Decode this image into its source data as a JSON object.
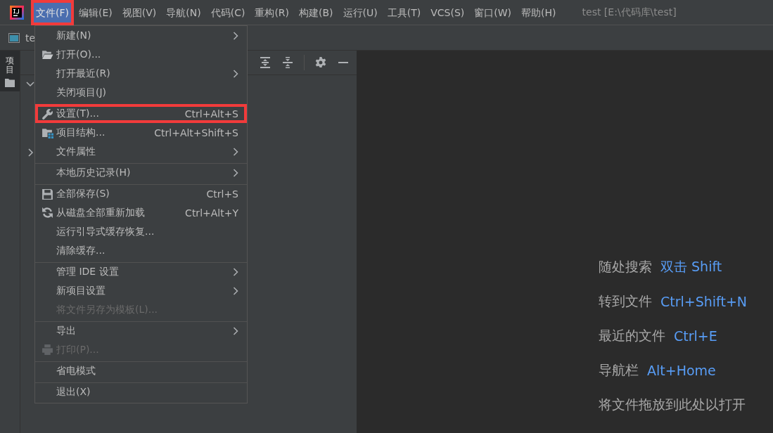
{
  "menubar": {
    "items": [
      {
        "label": "文件(F)",
        "selected": true,
        "outlined": true
      },
      {
        "label": "编辑(E)",
        "selected": false,
        "outlined": false
      },
      {
        "label": "视图(V)",
        "selected": false,
        "outlined": false
      },
      {
        "label": "导航(N)",
        "selected": false,
        "outlined": false
      },
      {
        "label": "代码(C)",
        "selected": false,
        "outlined": false
      },
      {
        "label": "重构(R)",
        "selected": false,
        "outlined": false
      },
      {
        "label": "构建(B)",
        "selected": false,
        "outlined": false
      },
      {
        "label": "运行(U)",
        "selected": false,
        "outlined": false
      },
      {
        "label": "工具(T)",
        "selected": false,
        "outlined": false
      },
      {
        "label": "VCS(S)",
        "selected": false,
        "outlined": false
      },
      {
        "label": "窗口(W)",
        "selected": false,
        "outlined": false
      },
      {
        "label": "帮助(H)",
        "selected": false,
        "outlined": false
      }
    ],
    "title": "test [E:\\代码库\\test]"
  },
  "tab": {
    "label": "te"
  },
  "side_tab": {
    "label": "项目",
    "selected": true
  },
  "file_menu": {
    "items": [
      {
        "kind": "plain",
        "label": "新建(N)",
        "submenu": true,
        "disabled": false,
        "outlined": false,
        "separator_before": false
      },
      {
        "kind": "folder",
        "label": "打开(O)...",
        "submenu": false,
        "disabled": false,
        "outlined": false,
        "separator_before": false
      },
      {
        "kind": "plain",
        "label": "打开最近(R)",
        "submenu": true,
        "disabled": false,
        "outlined": false,
        "separator_before": false
      },
      {
        "kind": "plain",
        "label": "关闭项目(J)",
        "submenu": false,
        "disabled": false,
        "outlined": false,
        "separator_before": false
      },
      {
        "kind": "wrench",
        "label": "设置(T)...",
        "shortcut": "Ctrl+Alt+S",
        "submenu": false,
        "disabled": false,
        "outlined": true,
        "separator_before": true
      },
      {
        "kind": "structure",
        "label": "项目结构...",
        "shortcut": "Ctrl+Alt+Shift+S",
        "submenu": false,
        "disabled": false,
        "outlined": false,
        "separator_before": false
      },
      {
        "kind": "plain",
        "label": "文件属性",
        "submenu": true,
        "disabled": false,
        "outlined": false,
        "separator_before": false
      },
      {
        "kind": "plain",
        "label": "本地历史记录(H)",
        "submenu": true,
        "disabled": false,
        "outlined": false,
        "separator_before": true
      },
      {
        "kind": "disk",
        "label": "全部保存(S)",
        "shortcut": "Ctrl+S",
        "submenu": false,
        "disabled": false,
        "outlined": false,
        "separator_before": true
      },
      {
        "kind": "reload",
        "label": "从磁盘全部重新加载",
        "shortcut": "Ctrl+Alt+Y",
        "submenu": false,
        "disabled": false,
        "outlined": false,
        "separator_before": false
      },
      {
        "kind": "plain",
        "label": "运行引导式缓存恢复...",
        "submenu": false,
        "disabled": false,
        "outlined": false,
        "separator_before": false
      },
      {
        "kind": "plain",
        "label": "清除缓存...",
        "submenu": false,
        "disabled": false,
        "outlined": false,
        "separator_before": false
      },
      {
        "kind": "plain",
        "label": "管理 IDE 设置",
        "submenu": true,
        "disabled": false,
        "outlined": false,
        "separator_before": true
      },
      {
        "kind": "plain",
        "label": "新项目设置",
        "submenu": true,
        "disabled": false,
        "outlined": false,
        "separator_before": false
      },
      {
        "kind": "plain",
        "label": "将文件另存为模板(L)...",
        "submenu": false,
        "disabled": true,
        "outlined": false,
        "separator_before": false
      },
      {
        "kind": "plain",
        "label": "导出",
        "submenu": true,
        "disabled": false,
        "outlined": false,
        "separator_before": true
      },
      {
        "kind": "printer",
        "label": "打印(P)...",
        "submenu": false,
        "disabled": true,
        "outlined": false,
        "separator_before": false
      },
      {
        "kind": "plain",
        "label": "省电模式",
        "submenu": false,
        "disabled": false,
        "outlined": false,
        "separator_before": true
      },
      {
        "kind": "plain",
        "label": "退出(X)",
        "submenu": false,
        "disabled": false,
        "outlined": false,
        "separator_before": true
      }
    ]
  },
  "editor_hints": [
    {
      "label": "随处搜索",
      "shortcut": "双击 Shift"
    },
    {
      "label": "转到文件",
      "shortcut": "Ctrl+Shift+N"
    },
    {
      "label": "最近的文件",
      "shortcut": "Ctrl+E"
    },
    {
      "label": "导航栏",
      "shortcut": "Alt+Home"
    },
    {
      "label": "将文件拖放到此处以打开"
    }
  ]
}
